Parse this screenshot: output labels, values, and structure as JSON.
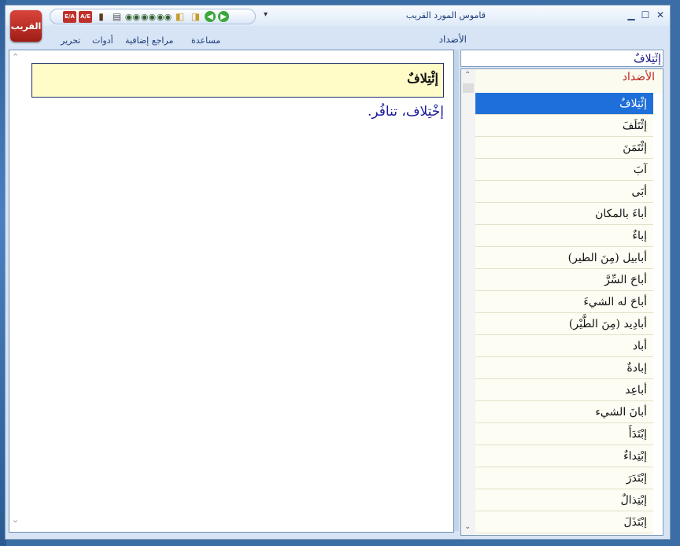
{
  "app_logo_text": "القريب",
  "window_title": "قاموس المورد القريب",
  "toolbar": {
    "ea_label": "E/A",
    "ae_label": "A/E",
    "more_arrow": "▾"
  },
  "menu": {
    "help": "مساعدة",
    "references": "مراجع إضافية",
    "tools": "أدوات",
    "edit": "تحرير"
  },
  "ribbon_section": "الأضداد",
  "entry": {
    "headword": "إئْتِلافٌ",
    "definition": "إخْتِلاف، تنافُر."
  },
  "search": {
    "value": "إئْتِلافٌ"
  },
  "list": {
    "title": "الأضداد",
    "selected_index": 0,
    "items": [
      "إئْتِلافٌ",
      "إئْتَلَفَ",
      "إئْتَمَنَ",
      "آبَ",
      "أبَى",
      "أباءَ بالمكان",
      "إباءٌ",
      "أبابيل (مِنَ الطير)",
      "أباحَ السِّرَّ",
      "أباحَ له الشيءَ",
      "أبادِيد (مِنَ الطَّيْر)",
      "أباد",
      "إبادةٌ",
      "أباعِد",
      "أبانَ الشيء",
      "إبْتَدَأَ",
      "إبْتِداءٌ",
      "إبْتَدَرَ",
      "إبْتِذالٌ",
      "إبْتَذَلَ"
    ]
  },
  "colors": {
    "accent": "#1e6fd9",
    "headword_bg": "#fffcc8",
    "definition_text": "#1a1a9a",
    "list_title": "#c0201a"
  }
}
